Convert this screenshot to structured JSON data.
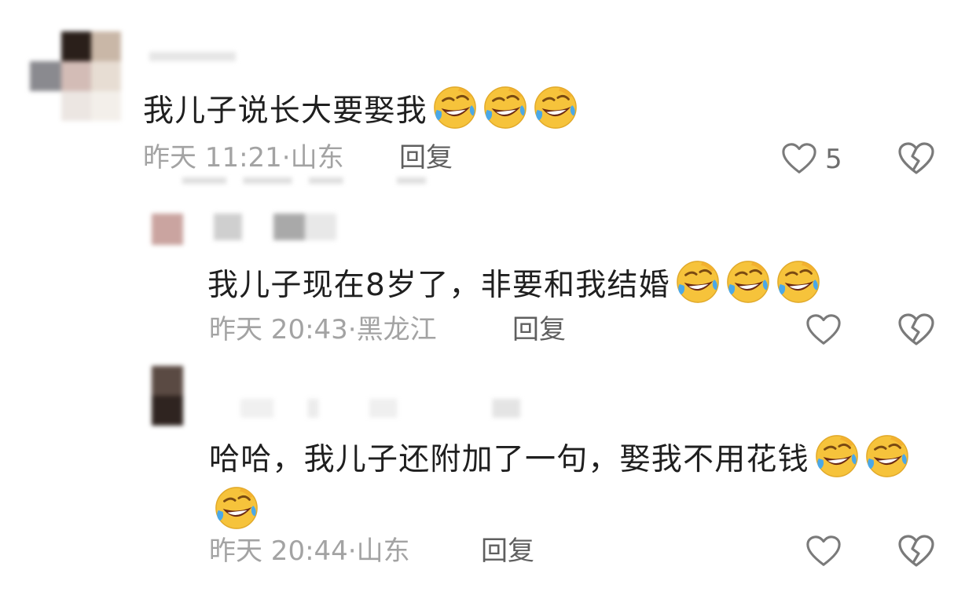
{
  "comments": [
    {
      "text": "我儿子说长大要娶我",
      "emojis": [
        "rofl-emoji",
        "rofl-emoji",
        "rofl-emoji"
      ],
      "time": "昨天 11:21",
      "location": "山东",
      "reply": "回复",
      "likes": "5"
    },
    {
      "text": "我儿子现在8岁了，非要和我结婚",
      "emojis": [
        "rofl-emoji",
        "rofl-emoji",
        "rofl-emoji"
      ],
      "time": "昨天 20:43",
      "location": "黑龙江",
      "reply": "回复",
      "likes": ""
    },
    {
      "text": "哈哈，我儿子还附加了一句，娶我不用花钱",
      "emojis": [
        "rofl-emoji",
        "rofl-emoji",
        "rofl-emoji"
      ],
      "time": "昨天 20:44",
      "location": "山东",
      "reply": "回复",
      "likes": ""
    }
  ],
  "separator": "·",
  "icons": {
    "like": "heart-outline-icon",
    "dislike": "broken-heart-icon"
  },
  "colors": {
    "text": "#1f1f1f",
    "meta": "#a3a3a3",
    "reply": "#5f5f5f",
    "icon": "#7a7a7a"
  }
}
